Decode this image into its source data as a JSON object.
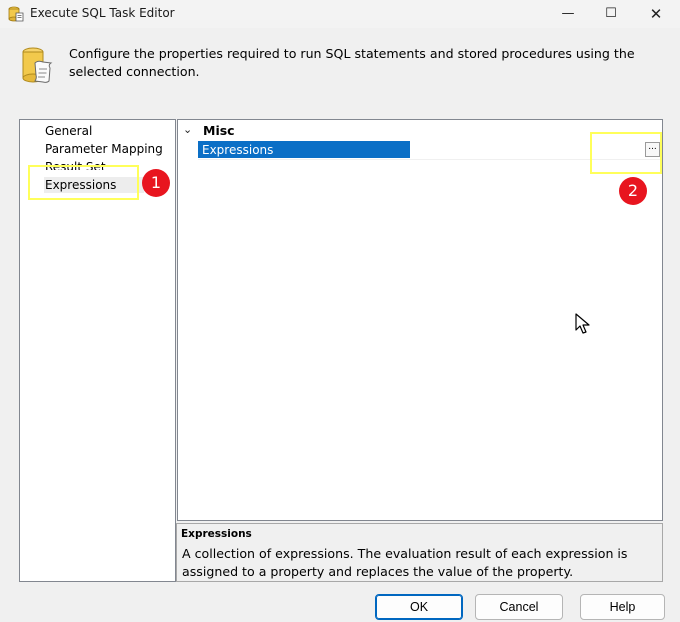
{
  "window": {
    "title": "Execute SQL Task Editor",
    "icon": "sql-task-icon",
    "controls": {
      "minimize": "—",
      "maximize": "☐",
      "close": "✕"
    }
  },
  "header": {
    "icon": "database-scroll-icon",
    "description": "Configure the properties required to run SQL statements and stored procedures using the selected connection."
  },
  "nav": {
    "items": [
      {
        "label": "General"
      },
      {
        "label": "Parameter Mapping"
      },
      {
        "label": "Result Set"
      },
      {
        "label": "Expressions",
        "selected": true
      }
    ]
  },
  "annotations": {
    "badge1": "1",
    "badge2": "2",
    "highlight_color": "#ffff5a",
    "badge_color": "#e8151f"
  },
  "property_grid": {
    "category": "Misc",
    "property_name": "Expressions",
    "ellipsis": "...",
    "selection_color": "#0b6fc6"
  },
  "description_panel": {
    "title": "Expressions",
    "text": "A collection of expressions. The evaluation result of each expression is assigned to a property and replaces the value of the property."
  },
  "buttons": {
    "ok": "OK",
    "cancel": "Cancel",
    "help": "Help"
  }
}
